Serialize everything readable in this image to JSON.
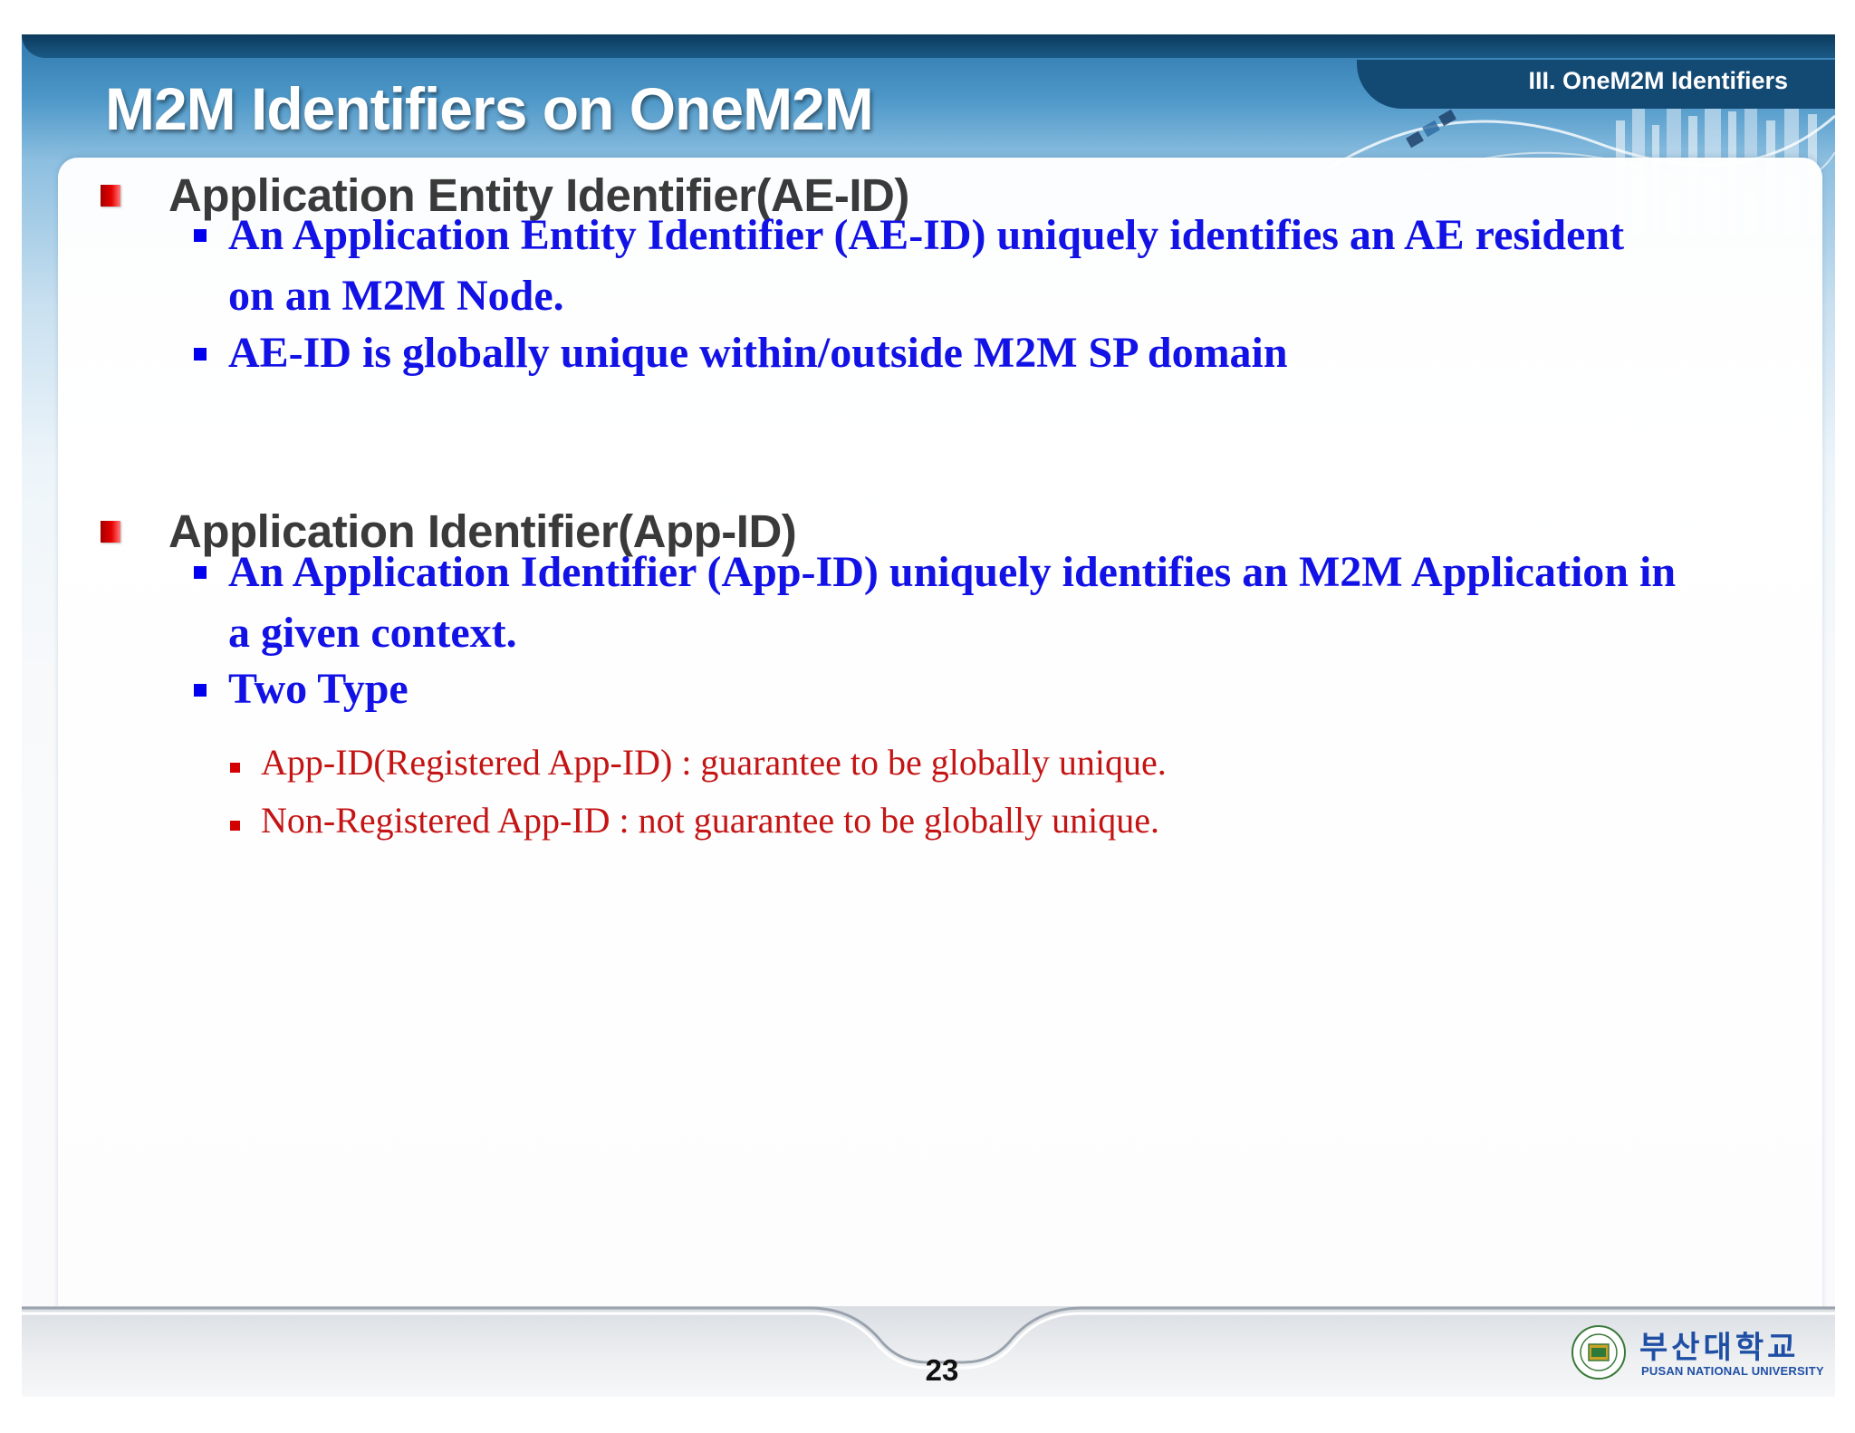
{
  "slide": {
    "title": "M2M Identifiers on OneM2M",
    "section_label": "III. OneM2M Identifiers",
    "page_number": "23"
  },
  "sections": [
    {
      "heading": "Application Entity Identifier(AE-ID)",
      "bullets": [
        "An Application Entity Identifier (AE-ID) uniquely identifies an AE resident on an M2M Node.",
        "AE-ID is globally unique within/outside M2M SP domain"
      ]
    },
    {
      "heading": "Application Identifier(App-ID)",
      "bullets": [
        "An Application Identifier (App-ID) uniquely identifies an M2M Application in a given context.",
        "Two Type"
      ],
      "sub_bullets": [
        "App-ID(Registered App-ID) : guarantee to be globally unique.",
        "Non-Registered App-ID : not guarantee to be globally unique."
      ]
    }
  ],
  "footer": {
    "logo_korean": "부산대학교",
    "logo_english": "PUSAN NATIONAL UNIVERSITY"
  },
  "colors": {
    "title_blue": "#2f78ad",
    "bullet_text_blue": "#1212e6",
    "sub_bullet_red": "#c41414",
    "marker_red": "#e60000",
    "logo_blue": "#1f4fa5"
  }
}
